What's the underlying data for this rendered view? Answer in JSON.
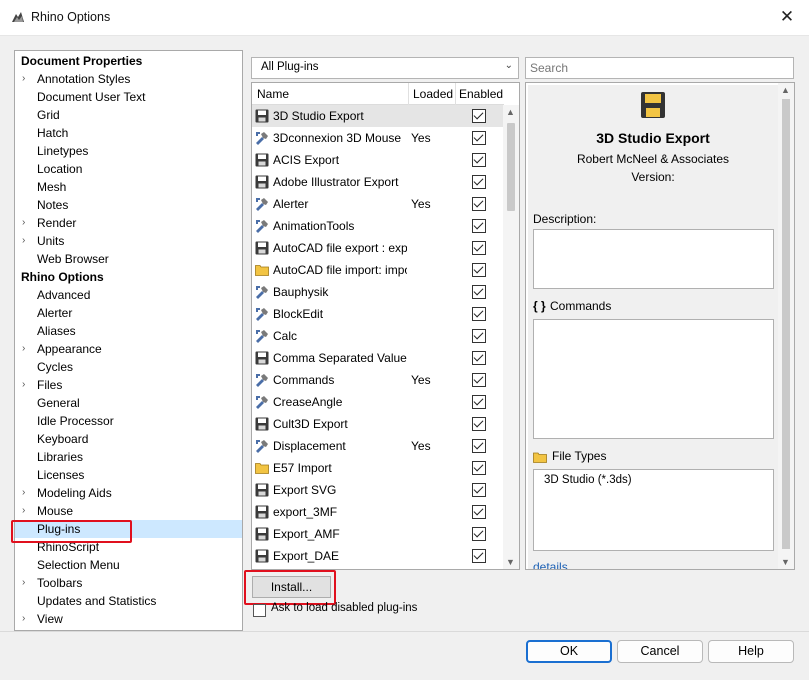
{
  "window": {
    "title": "Rhino Options",
    "close_glyph": "✕"
  },
  "sidebar": {
    "items": [
      {
        "label": "Document Properties",
        "header": true,
        "arrow": ""
      },
      {
        "label": "Annotation Styles",
        "arrow": "›"
      },
      {
        "label": "Document User Text",
        "arrow": ""
      },
      {
        "label": "Grid",
        "arrow": ""
      },
      {
        "label": "Hatch",
        "arrow": ""
      },
      {
        "label": "Linetypes",
        "arrow": ""
      },
      {
        "label": "Location",
        "arrow": ""
      },
      {
        "label": "Mesh",
        "arrow": ""
      },
      {
        "label": "Notes",
        "arrow": ""
      },
      {
        "label": "Render",
        "arrow": "›"
      },
      {
        "label": "Units",
        "arrow": "›"
      },
      {
        "label": "Web Browser",
        "arrow": ""
      },
      {
        "label": "Rhino Options",
        "header": true,
        "arrow": ""
      },
      {
        "label": "Advanced",
        "arrow": ""
      },
      {
        "label": "Alerter",
        "arrow": ""
      },
      {
        "label": "Aliases",
        "arrow": ""
      },
      {
        "label": "Appearance",
        "arrow": "›"
      },
      {
        "label": "Cycles",
        "arrow": ""
      },
      {
        "label": "Files",
        "arrow": "›"
      },
      {
        "label": "General",
        "arrow": ""
      },
      {
        "label": "Idle Processor",
        "arrow": ""
      },
      {
        "label": "Keyboard",
        "arrow": ""
      },
      {
        "label": "Libraries",
        "arrow": ""
      },
      {
        "label": "Licenses",
        "arrow": ""
      },
      {
        "label": "Modeling Aids",
        "arrow": "›"
      },
      {
        "label": "Mouse",
        "arrow": "›"
      },
      {
        "label": "Plug-ins",
        "arrow": "",
        "selected": true
      },
      {
        "label": "RhinoScript",
        "arrow": ""
      },
      {
        "label": "Selection Menu",
        "arrow": ""
      },
      {
        "label": "Toolbars",
        "arrow": "›"
      },
      {
        "label": "Updates and Statistics",
        "arrow": ""
      },
      {
        "label": "View",
        "arrow": "›"
      }
    ]
  },
  "filter": {
    "selected": "All Plug-ins",
    "chevron": "⌄"
  },
  "search": {
    "placeholder": "Search",
    "value": ""
  },
  "plugin_table": {
    "columns": [
      "Name",
      "Loaded",
      "Enabled"
    ],
    "rows": [
      {
        "name": "3D Studio Export",
        "loaded": "",
        "enabled": true,
        "icon": "floppy-icon",
        "selected": true
      },
      {
        "name": "3Dconnexion 3D Mouse",
        "loaded": "Yes",
        "enabled": true,
        "icon": "plugin-icon"
      },
      {
        "name": "ACIS Export",
        "loaded": "",
        "enabled": true,
        "icon": "floppy-icon"
      },
      {
        "name": "Adobe Illustrator Export",
        "loaded": "",
        "enabled": true,
        "icon": "floppy-icon"
      },
      {
        "name": "Alerter",
        "loaded": "Yes",
        "enabled": true,
        "icon": "plugin-icon"
      },
      {
        "name": "AnimationTools",
        "loaded": "",
        "enabled": true,
        "icon": "plugin-icon"
      },
      {
        "name": "AutoCAD file export : export_",
        "loaded": "",
        "enabled": true,
        "icon": "floppy-icon"
      },
      {
        "name": "AutoCAD file import: import_",
        "loaded": "",
        "enabled": true,
        "icon": "folder-icon"
      },
      {
        "name": "Bauphysik",
        "loaded": "",
        "enabled": true,
        "icon": "plugin-icon"
      },
      {
        "name": "BlockEdit",
        "loaded": "",
        "enabled": true,
        "icon": "plugin-icon"
      },
      {
        "name": "Calc",
        "loaded": "",
        "enabled": true,
        "icon": "plugin-icon"
      },
      {
        "name": "Comma Separated Value Ex",
        "loaded": "",
        "enabled": true,
        "icon": "floppy-icon"
      },
      {
        "name": "Commands",
        "loaded": "Yes",
        "enabled": true,
        "icon": "plugin-icon"
      },
      {
        "name": "CreaseAngle",
        "loaded": "",
        "enabled": true,
        "icon": "plugin-icon"
      },
      {
        "name": "Cult3D Export",
        "loaded": "",
        "enabled": true,
        "icon": "floppy-icon"
      },
      {
        "name": "Displacement",
        "loaded": "Yes",
        "enabled": true,
        "icon": "plugin-icon"
      },
      {
        "name": "E57 Import",
        "loaded": "",
        "enabled": true,
        "icon": "folder-icon"
      },
      {
        "name": "Export SVG",
        "loaded": "",
        "enabled": true,
        "icon": "floppy-icon"
      },
      {
        "name": "export_3MF",
        "loaded": "",
        "enabled": true,
        "icon": "floppy-icon"
      },
      {
        "name": "Export_AMF",
        "loaded": "",
        "enabled": true,
        "icon": "floppy-icon"
      },
      {
        "name": "Export_DAE",
        "loaded": "",
        "enabled": true,
        "icon": "floppy-icon"
      }
    ]
  },
  "install_button": "Install...",
  "ask_checkbox": {
    "label": "Ask to load disabled plug-ins",
    "checked": false
  },
  "details": {
    "name": "3D Studio Export",
    "author": "Robert McNeel & Associates",
    "version_label": "Version:",
    "description_label": "Description:",
    "commands_label": "Commands",
    "commands_glyph": "{ }",
    "file_types_label": "File Types",
    "file_types": "3D Studio (*.3ds)",
    "details_link": "details"
  },
  "buttons": {
    "ok": "OK",
    "cancel": "Cancel",
    "help": "Help"
  },
  "colors": {
    "accent": "#1a6fd1",
    "highlight_box": "#e0101e",
    "selected_row": "#cde8ff",
    "floppy": "#3a3a3a",
    "folder": "#f2c443"
  }
}
